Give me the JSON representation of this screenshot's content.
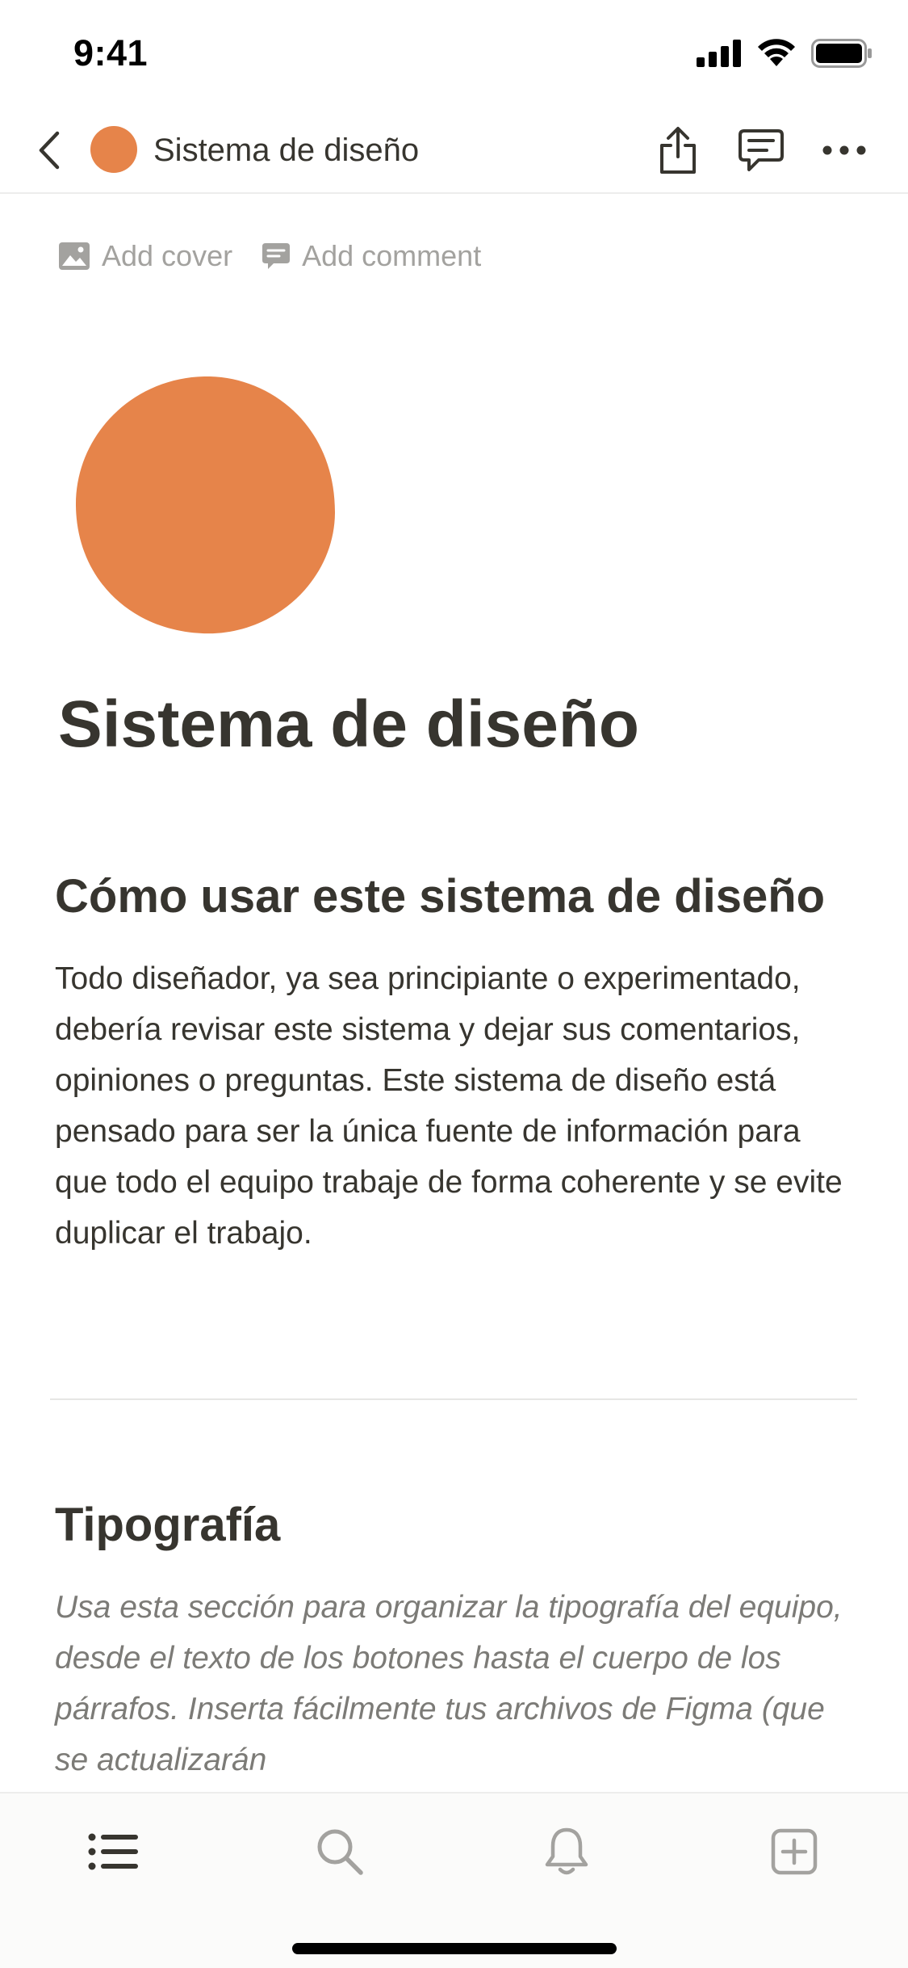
{
  "status_bar": {
    "time": "9:41",
    "icons": [
      "cellular-signal-icon",
      "wifi-icon",
      "battery-icon"
    ]
  },
  "nav": {
    "title": "Sistema de diseño",
    "icons": [
      "back-chevron-icon",
      "share-icon",
      "comment-icon",
      "more-icon"
    ]
  },
  "page_actions": {
    "add_cover": "Add cover",
    "add_comment": "Add comment"
  },
  "page": {
    "icon_color": "#e6844a",
    "title": "Sistema de diseño",
    "sections": [
      {
        "heading": "Cómo usar este sistema de diseño",
        "body": "Todo diseñador, ya sea principiante o experimentado, debería revisar este sistema y dejar sus comentarios, opiniones o preguntas. Este sistema de diseño está pensado para ser la única fuente de información para que todo el equipo trabaje de forma coherente y se evite duplicar el trabajo."
      },
      {
        "heading": "Tipografía",
        "body": "Usa esta sección para organizar la tipografía del equipo, desde el texto de los botones hasta el cuerpo de los párrafos. Inserta fácilmente tus archivos de Figma (que se actualizarán"
      }
    ]
  },
  "tab_bar": {
    "icons": [
      "list-icon",
      "search-icon",
      "bell-icon",
      "add-page-icon"
    ]
  },
  "colors": {
    "text": "#37352f",
    "muted": "#a3a29f",
    "accent_orange": "#e6844a"
  }
}
